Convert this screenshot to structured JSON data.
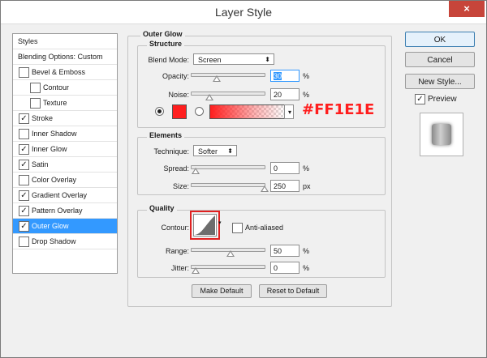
{
  "window": {
    "title": "Layer Style",
    "close_glyph": "×"
  },
  "styles_list": {
    "items": [
      {
        "label": "Styles",
        "kind": "header",
        "check": false
      },
      {
        "label": "Blending Options: Custom",
        "kind": "header",
        "check": false
      },
      {
        "label": "Bevel & Emboss",
        "kind": "item",
        "check": false
      },
      {
        "label": "Contour",
        "kind": "sub",
        "check": false
      },
      {
        "label": "Texture",
        "kind": "sub",
        "check": false
      },
      {
        "label": "Stroke",
        "kind": "item",
        "check": true
      },
      {
        "label": "Inner Shadow",
        "kind": "item",
        "check": false
      },
      {
        "label": "Inner Glow",
        "kind": "item",
        "check": true
      },
      {
        "label": "Satin",
        "kind": "item",
        "check": true
      },
      {
        "label": "Color Overlay",
        "kind": "item",
        "check": false
      },
      {
        "label": "Gradient Overlay",
        "kind": "item",
        "check": true
      },
      {
        "label": "Pattern Overlay",
        "kind": "item",
        "check": true
      },
      {
        "label": "Outer Glow",
        "kind": "item",
        "check": true,
        "selected": true
      },
      {
        "label": "Drop Shadow",
        "kind": "item",
        "check": false
      }
    ]
  },
  "outer_glow": {
    "title": "Outer Glow",
    "structure": {
      "label": "Structure",
      "blend_mode_label": "Blend Mode:",
      "blend_mode_value": "Screen",
      "opacity_label": "Opacity:",
      "opacity_value": "30",
      "opacity_percent": 30,
      "noise_label": "Noise:",
      "noise_value": "20",
      "noise_percent": 20,
      "percent_unit": "%",
      "glow_color": "#FF1E1E",
      "color_label": "#FF1E1E"
    },
    "elements": {
      "label": "Elements",
      "technique_label": "Technique:",
      "technique_value": "Softer",
      "spread_label": "Spread:",
      "spread_value": "0",
      "spread_percent": 0,
      "size_label": "Size:",
      "size_value": "250",
      "size_unit": "px"
    },
    "quality": {
      "label": "Quality",
      "contour_label": "Contour:",
      "anti_aliased_label": "Anti-aliased",
      "anti_aliased": false,
      "range_label": "Range:",
      "range_value": "50",
      "range_percent": 50,
      "jitter_label": "Jitter:",
      "jitter_value": "0",
      "jitter_percent": 0
    },
    "make_default_label": "Make Default",
    "reset_default_label": "Reset to Default"
  },
  "buttons": {
    "ok": "OK",
    "cancel": "Cancel",
    "new_style": "New Style...",
    "preview": "Preview",
    "preview_checked": true
  },
  "colors": {
    "selection": "#3399ff",
    "highlight_box": "#e02020"
  }
}
